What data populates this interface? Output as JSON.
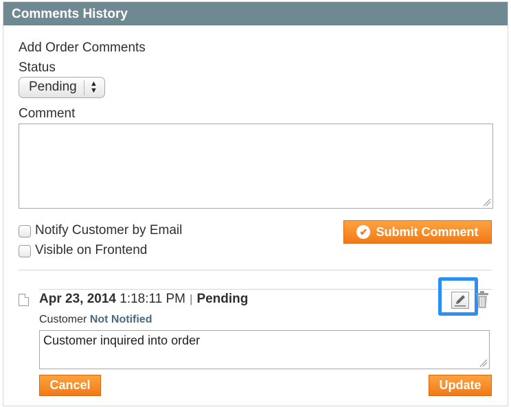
{
  "header": {
    "title": "Comments History"
  },
  "form": {
    "heading": "Add Order Comments",
    "status_label": "Status",
    "status_value": "Pending",
    "comment_label": "Comment",
    "comment_value": "",
    "notify_label": "Notify Customer by Email",
    "visible_label": "Visible on Frontend",
    "submit_label": "Submit Comment"
  },
  "entry": {
    "date": "Apr 23, 2014",
    "time": "1:18:11 PM",
    "separator": "|",
    "status": "Pending",
    "customer_label": "Customer",
    "notified_status": "Not Notified",
    "comment_text": "Customer inquired into order",
    "cancel_label": "Cancel",
    "update_label": "Update"
  },
  "icons": {
    "submit": "checkmark-circle-icon",
    "document": "document-icon",
    "edit": "edit-pencil-icon",
    "delete": "trash-icon"
  },
  "colors": {
    "header_bg": "#6f8992",
    "button": "#f58a21",
    "highlight": "#2c8ff3",
    "notified_text": "#466b7e"
  }
}
